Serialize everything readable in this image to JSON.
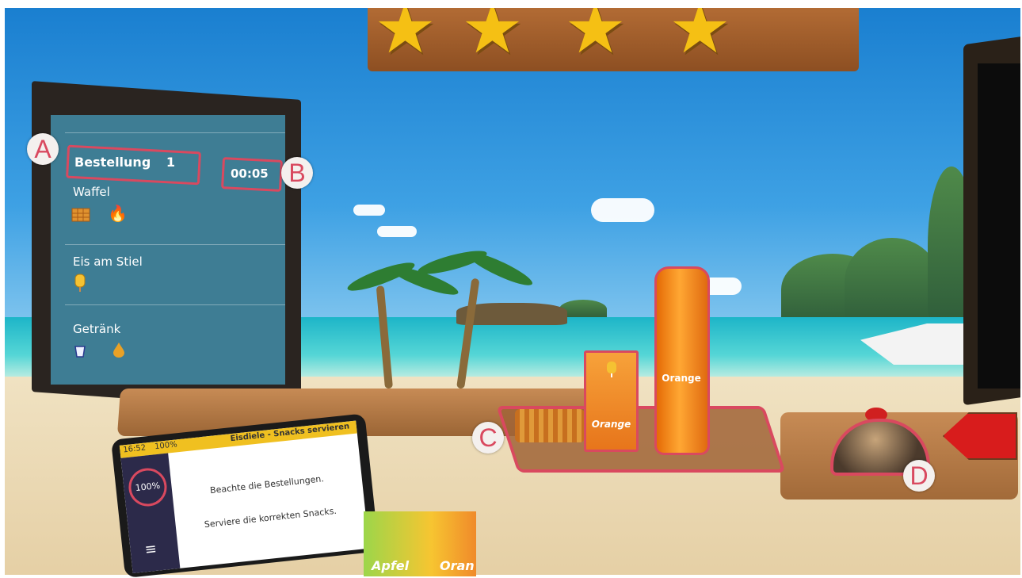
{
  "order_board": {
    "order_label": "Bestellung",
    "order_number": "1",
    "timer": "00:05",
    "items": [
      {
        "name": "Waffel",
        "icons": [
          "waffle-icon",
          "fire-icon"
        ]
      },
      {
        "name": "Eis am Stiel",
        "icons": [
          "popsicle-icon"
        ]
      },
      {
        "name": "Getränk",
        "icons": [
          "cup-icon",
          "drop-icon"
        ]
      }
    ]
  },
  "markers": {
    "a": "A",
    "b": "B",
    "c": "C",
    "d": "D"
  },
  "counter": {
    "popsicle_card_label": "Orange",
    "bottle_label": "Orange"
  },
  "tablet": {
    "status_time": "16:52",
    "status_battery": "100%",
    "status_title": "Eisdiele - Snacks servieren",
    "progress": "100%",
    "instruction_1": "Beachte die Bestellungen.",
    "instruction_2": "Serviere die korrekten Snacks."
  },
  "poster": {
    "left_label": "Apfel",
    "right_label": "Oran"
  },
  "colors": {
    "highlight": "#d9495f",
    "board": "#3e7d94",
    "star": "#f5c014"
  }
}
